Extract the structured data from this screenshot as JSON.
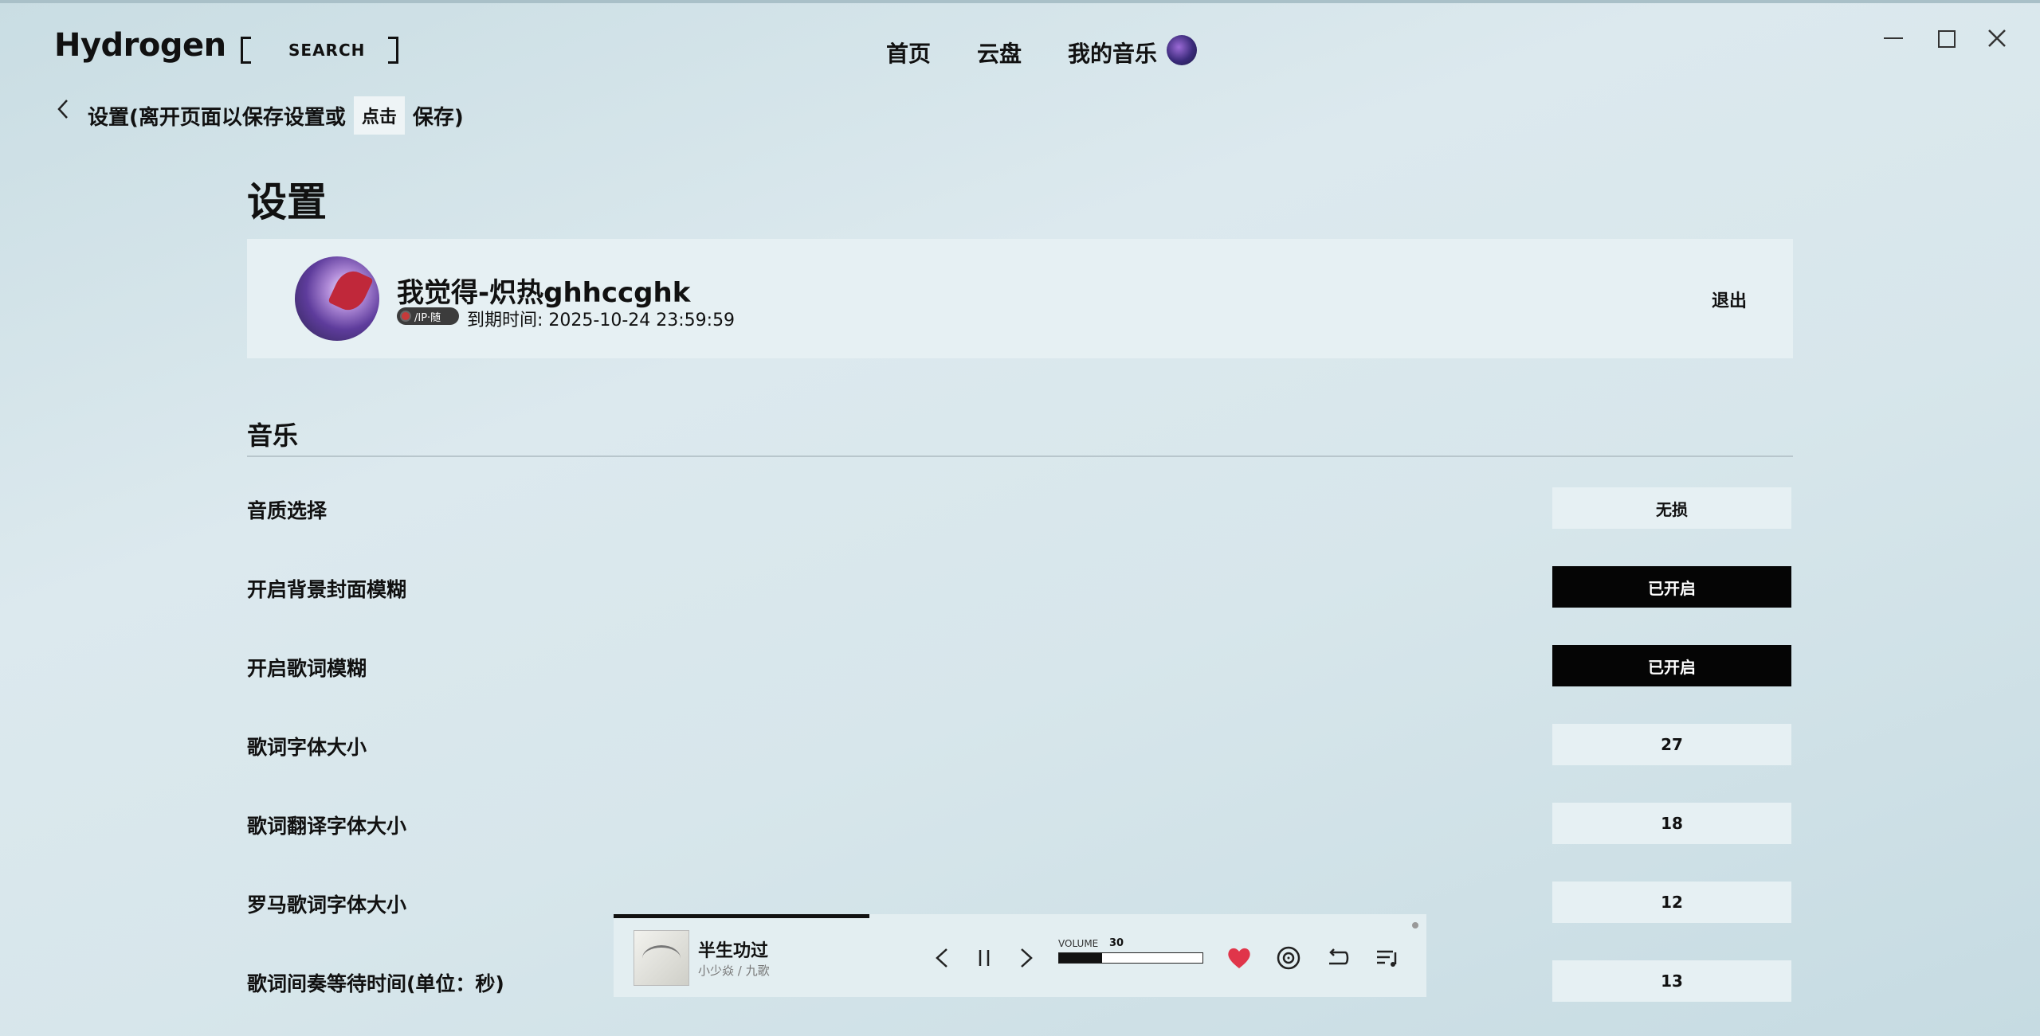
{
  "app": {
    "title": "Hydrogen"
  },
  "search": {
    "label": "SEARCH"
  },
  "nav": {
    "home": "首页",
    "cloud": "云盘",
    "my_music": "我的音乐"
  },
  "breadcrumb": {
    "text_before": "设置(离开页面以保存设置或",
    "click": "点击",
    "text_after": "保存)"
  },
  "page": {
    "title": "设置"
  },
  "profile": {
    "name": "我觉得-炽热ghhccghk",
    "badge": "/IP·随",
    "expire": "到期时间: 2025-10-24 23:59:59",
    "logout": "退出"
  },
  "sections": [
    {
      "title": "音乐",
      "rows": [
        {
          "label": "音质选择",
          "value": "无损",
          "state": "normal"
        },
        {
          "label": "开启背景封面模糊",
          "value": "已开启",
          "state": "on"
        },
        {
          "label": "开启歌词模糊",
          "value": "已开启",
          "state": "on"
        },
        {
          "label": "歌词字体大小",
          "value": "27",
          "state": "normal"
        },
        {
          "label": "歌词翻译字体大小",
          "value": "18",
          "state": "normal"
        },
        {
          "label": "罗马歌词字体大小",
          "value": "12",
          "state": "normal"
        },
        {
          "label": "歌词间奏等待时间(单位：秒)",
          "value": "13",
          "state": "normal"
        }
      ]
    }
  ],
  "player": {
    "song": "半生功过",
    "artist": "小少焱 / 九歌",
    "progress": 0.315,
    "volume_label": "VOLUME",
    "volume": 30
  },
  "colors": {
    "accent_on": "#050505",
    "heart": "#e0354a",
    "panel": "#e6f0f3"
  }
}
